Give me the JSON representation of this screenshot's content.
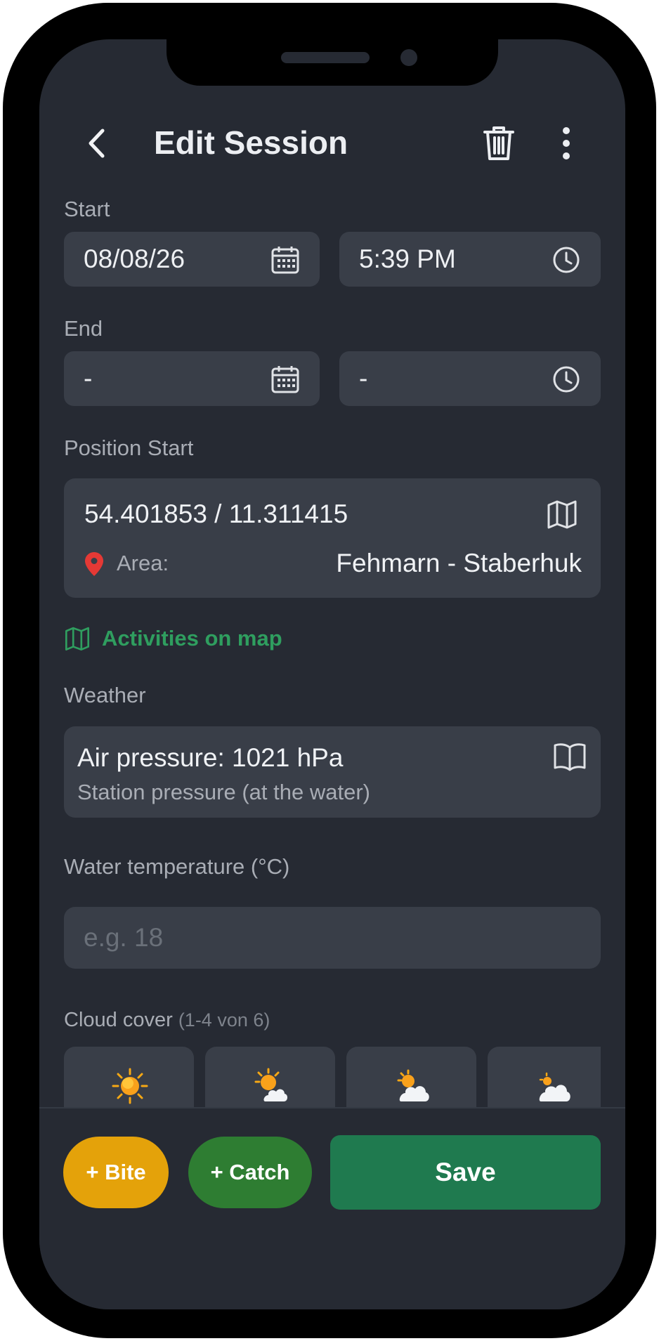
{
  "header": {
    "title": "Edit Session"
  },
  "start": {
    "label": "Start",
    "date": "08/08/26",
    "time": "5:39 PM"
  },
  "end": {
    "label": "End",
    "date": "-",
    "time": "-"
  },
  "position": {
    "label": "Position Start",
    "coords": "54.401853 / 11.311415",
    "area_label": "Area:",
    "area_value": "Fehmarn - Staberhuk"
  },
  "activities_link": "Activities on map",
  "weather": {
    "label": "Weather",
    "pressure": "Air pressure: 1021 hPa",
    "subtitle": "Station pressure (at the water)"
  },
  "water_temp": {
    "label": "Water temperature (°C)",
    "placeholder": "e.g. 18"
  },
  "cloud_cover": {
    "label": "Cloud cover",
    "hint": "(1-4 von 6)",
    "options": [
      "sun-icon",
      "sun-small-cloud-icon",
      "sun-behind-cloud-icon",
      "cloud-small-sun-icon"
    ]
  },
  "buttons": {
    "bite": "+ Bite",
    "catch": "+ Catch",
    "save": "Save"
  },
  "colors": {
    "background": "#262a33",
    "field": "#393e48",
    "bite": "#e4a20a",
    "catch": "#2e7d32",
    "save": "#1f7a4f",
    "link": "#2f9e5f",
    "pin": "#e53935"
  }
}
